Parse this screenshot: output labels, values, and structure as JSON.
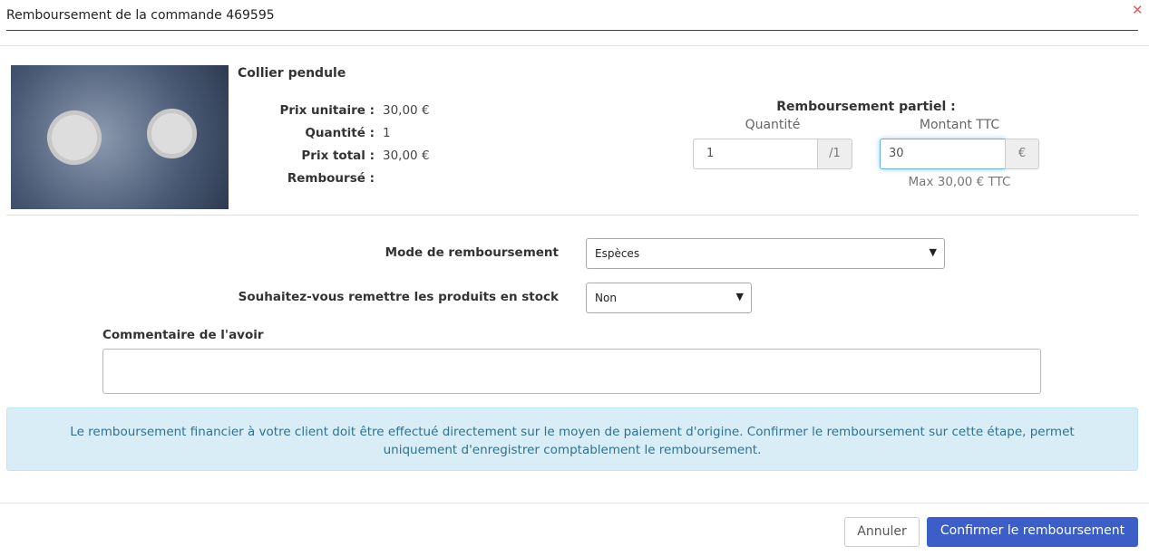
{
  "modal": {
    "title": "Remboursement de la commande 469595",
    "close_icon": "close-x-icon"
  },
  "product": {
    "name": "Collier pendule",
    "unit_price_label": "Prix unitaire :",
    "unit_price": "30,00 €",
    "quantity_label": "Quantité :",
    "quantity": "1",
    "total_label": "Prix total :",
    "total": "30,00 €",
    "refunded_label": "Remboursé :"
  },
  "partial": {
    "title": "Remboursement partiel :",
    "qty_label": "Quantité",
    "qty_value": "1",
    "qty_max": "/1",
    "amount_label": "Montant TTC",
    "amount_value": "30",
    "currency": "€",
    "max_text": "Max 30,00 € TTC"
  },
  "form": {
    "mode_label": "Mode de remboursement",
    "mode_value": "Espèces",
    "stock_label": "Souhaitez-vous remettre les produits en stock",
    "stock_value": "Non",
    "comment_label": "Commentaire de l'avoir",
    "comment_value": ""
  },
  "info": "Le remboursement financier à votre client doit être effectué directement sur le moyen de paiement d'origine. Confirmer le remboursement sur cette étape, permet uniquement d'enregistrer comptablement le remboursement.",
  "footer": {
    "cancel": "Annuler",
    "confirm": "Confirmer le remboursement",
    "confirm_color": "#3b5fc7"
  }
}
